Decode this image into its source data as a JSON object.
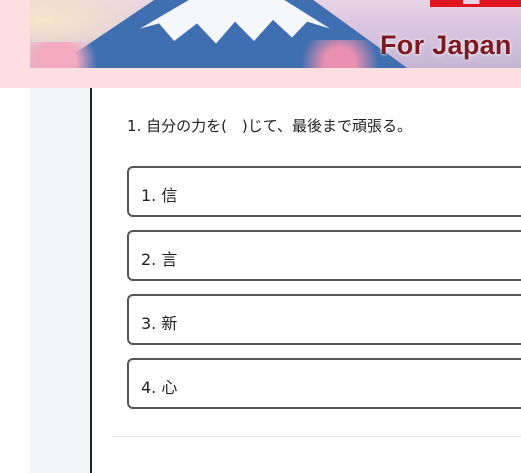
{
  "banner": {
    "subtitle": "For Japan",
    "colors": {
      "background": "#fddfe2",
      "title_red": "#e0141c",
      "subtitle": "#7a1a22"
    }
  },
  "quiz": {
    "question": "1. 自分の力を(　)じて、最後まで頑張る。",
    "options": [
      {
        "label": "1. 信"
      },
      {
        "label": "2. 言"
      },
      {
        "label": "3. 新"
      },
      {
        "label": "4. 心"
      }
    ]
  }
}
